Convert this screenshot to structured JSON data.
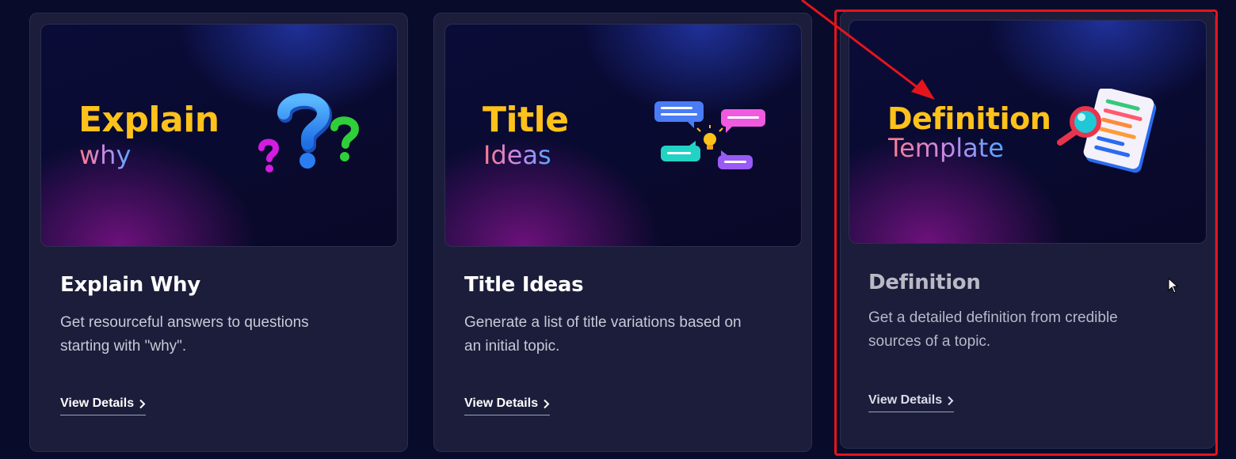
{
  "cards": [
    {
      "thumbnail": {
        "title": "Explain",
        "subtitle": "why",
        "art_icon": "question-marks-icon"
      },
      "title": "Explain Why",
      "description": "Get resourceful answers to questions starting with \"why\".",
      "link_label": "View Details"
    },
    {
      "thumbnail": {
        "title": "Title",
        "subtitle": "Ideas",
        "art_icon": "chat-bubbles-lightbulb-icon"
      },
      "title": "Title Ideas",
      "description": "Generate a list of title variations based on an initial topic.",
      "link_label": "View Details"
    },
    {
      "thumbnail": {
        "title": "Definition",
        "subtitle": "Template",
        "art_icon": "document-magnifier-icon"
      },
      "title": "Definition",
      "description": "Get a detailed definition from credible sources of a topic.",
      "link_label": "View Details",
      "highlighted": true
    }
  ],
  "annotation": {
    "color": "#e3151c",
    "arrow_icon": "red-arrow-icon"
  },
  "colors": {
    "background": "#080b2a",
    "card": "#1b1d3a",
    "thumb_title": "#ffc21a"
  }
}
